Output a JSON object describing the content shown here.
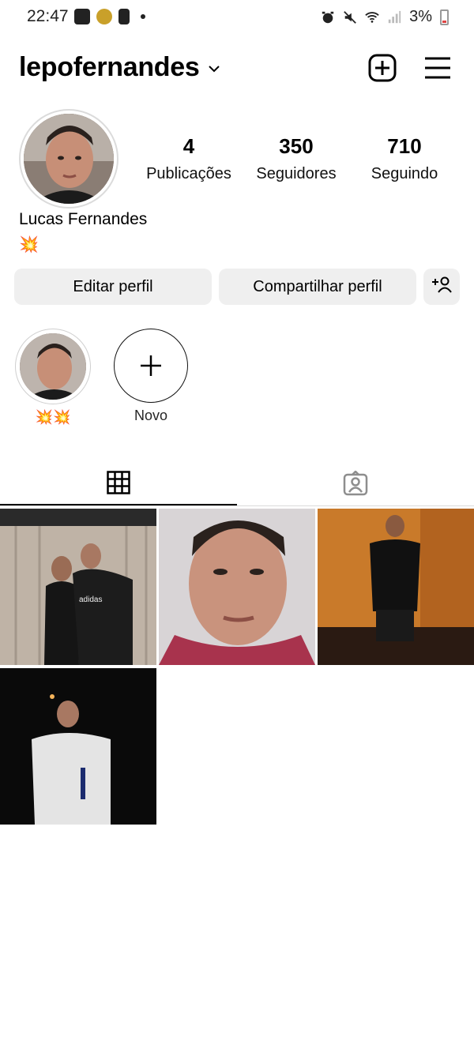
{
  "status_bar": {
    "time": "22:47",
    "battery": "3%",
    "icons_left": [
      "voicemail-icon",
      "media-icon",
      "alert-icon",
      "dot-icon"
    ],
    "icons_right": [
      "alarm-icon",
      "mute-icon",
      "wifi-icon",
      "signal-icon",
      "battery-icon"
    ]
  },
  "header": {
    "username": "lepofernandes",
    "icons": [
      "chevron-down-icon",
      "new-post-icon",
      "menu-icon"
    ]
  },
  "profile": {
    "stats": [
      {
        "count": "4",
        "label": "Publicações"
      },
      {
        "count": "350",
        "label": "Seguidores"
      },
      {
        "count": "710",
        "label": "Seguindo"
      }
    ],
    "full_name": "Lucas Fernandes",
    "bio": "💥",
    "buttons": {
      "edit": "Editar perfil",
      "share": "Compartilhar perfil"
    }
  },
  "highlights": [
    {
      "label": "💥💥",
      "type": "photo"
    },
    {
      "label": "Novo",
      "type": "new"
    }
  ],
  "tabs": [
    {
      "name": "grid",
      "icon": "grid-icon",
      "active": true
    },
    {
      "name": "tagged",
      "icon": "tagged-icon",
      "active": false
    }
  ],
  "posts": [
    {
      "subject": "couple-wall-photo"
    },
    {
      "subject": "selfie-closeup"
    },
    {
      "subject": "man-orange-wall"
    },
    {
      "subject": "man-night-bottle"
    }
  ],
  "colors": {
    "button_bg": "#efefef",
    "border": "#dbdbdb",
    "text": "#000000"
  }
}
